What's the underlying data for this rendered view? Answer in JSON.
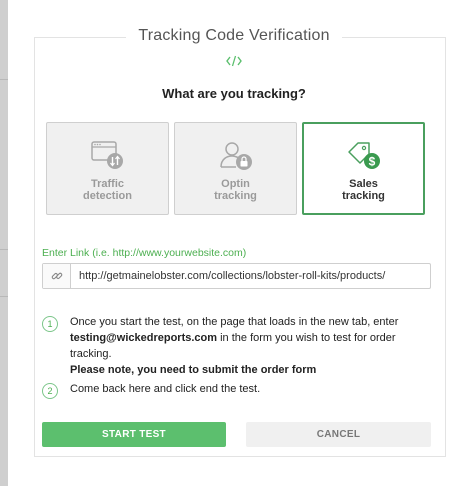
{
  "dialog": {
    "title": "Tracking Code Verification",
    "question": "What are you tracking?"
  },
  "options": [
    {
      "label_line1": "Traffic",
      "label_line2": "detection",
      "icon": "traffic-detection-icon",
      "selected": false
    },
    {
      "label_line1": "Optin",
      "label_line2": "tracking",
      "icon": "optin-tracking-icon",
      "selected": false
    },
    {
      "label_line1": "Sales",
      "label_line2": "tracking",
      "icon": "sales-tracking-icon",
      "selected": true
    }
  ],
  "link": {
    "label": "Enter Link (i.e. http://www.yourwebsite.com)",
    "value": "http://getmainelobster.com/collections/lobster-roll-kits/products/",
    "icon": "link-icon"
  },
  "steps": [
    {
      "number": "1",
      "text_before": "Once you start the test, on the page that loads in the new tab, enter",
      "email": "testing@wickedreports.com",
      "text_after": " in the form you wish to test for order tracking.",
      "note": "Please note, you need to submit the order form"
    },
    {
      "number": "2",
      "text": "Come back here and click end the test."
    }
  ],
  "buttons": {
    "start": "START TEST",
    "cancel": "CANCEL"
  },
  "colors": {
    "accent": "#5cbf6e",
    "selected_border": "#4a9f5e",
    "link_label": "#4caf50"
  }
}
